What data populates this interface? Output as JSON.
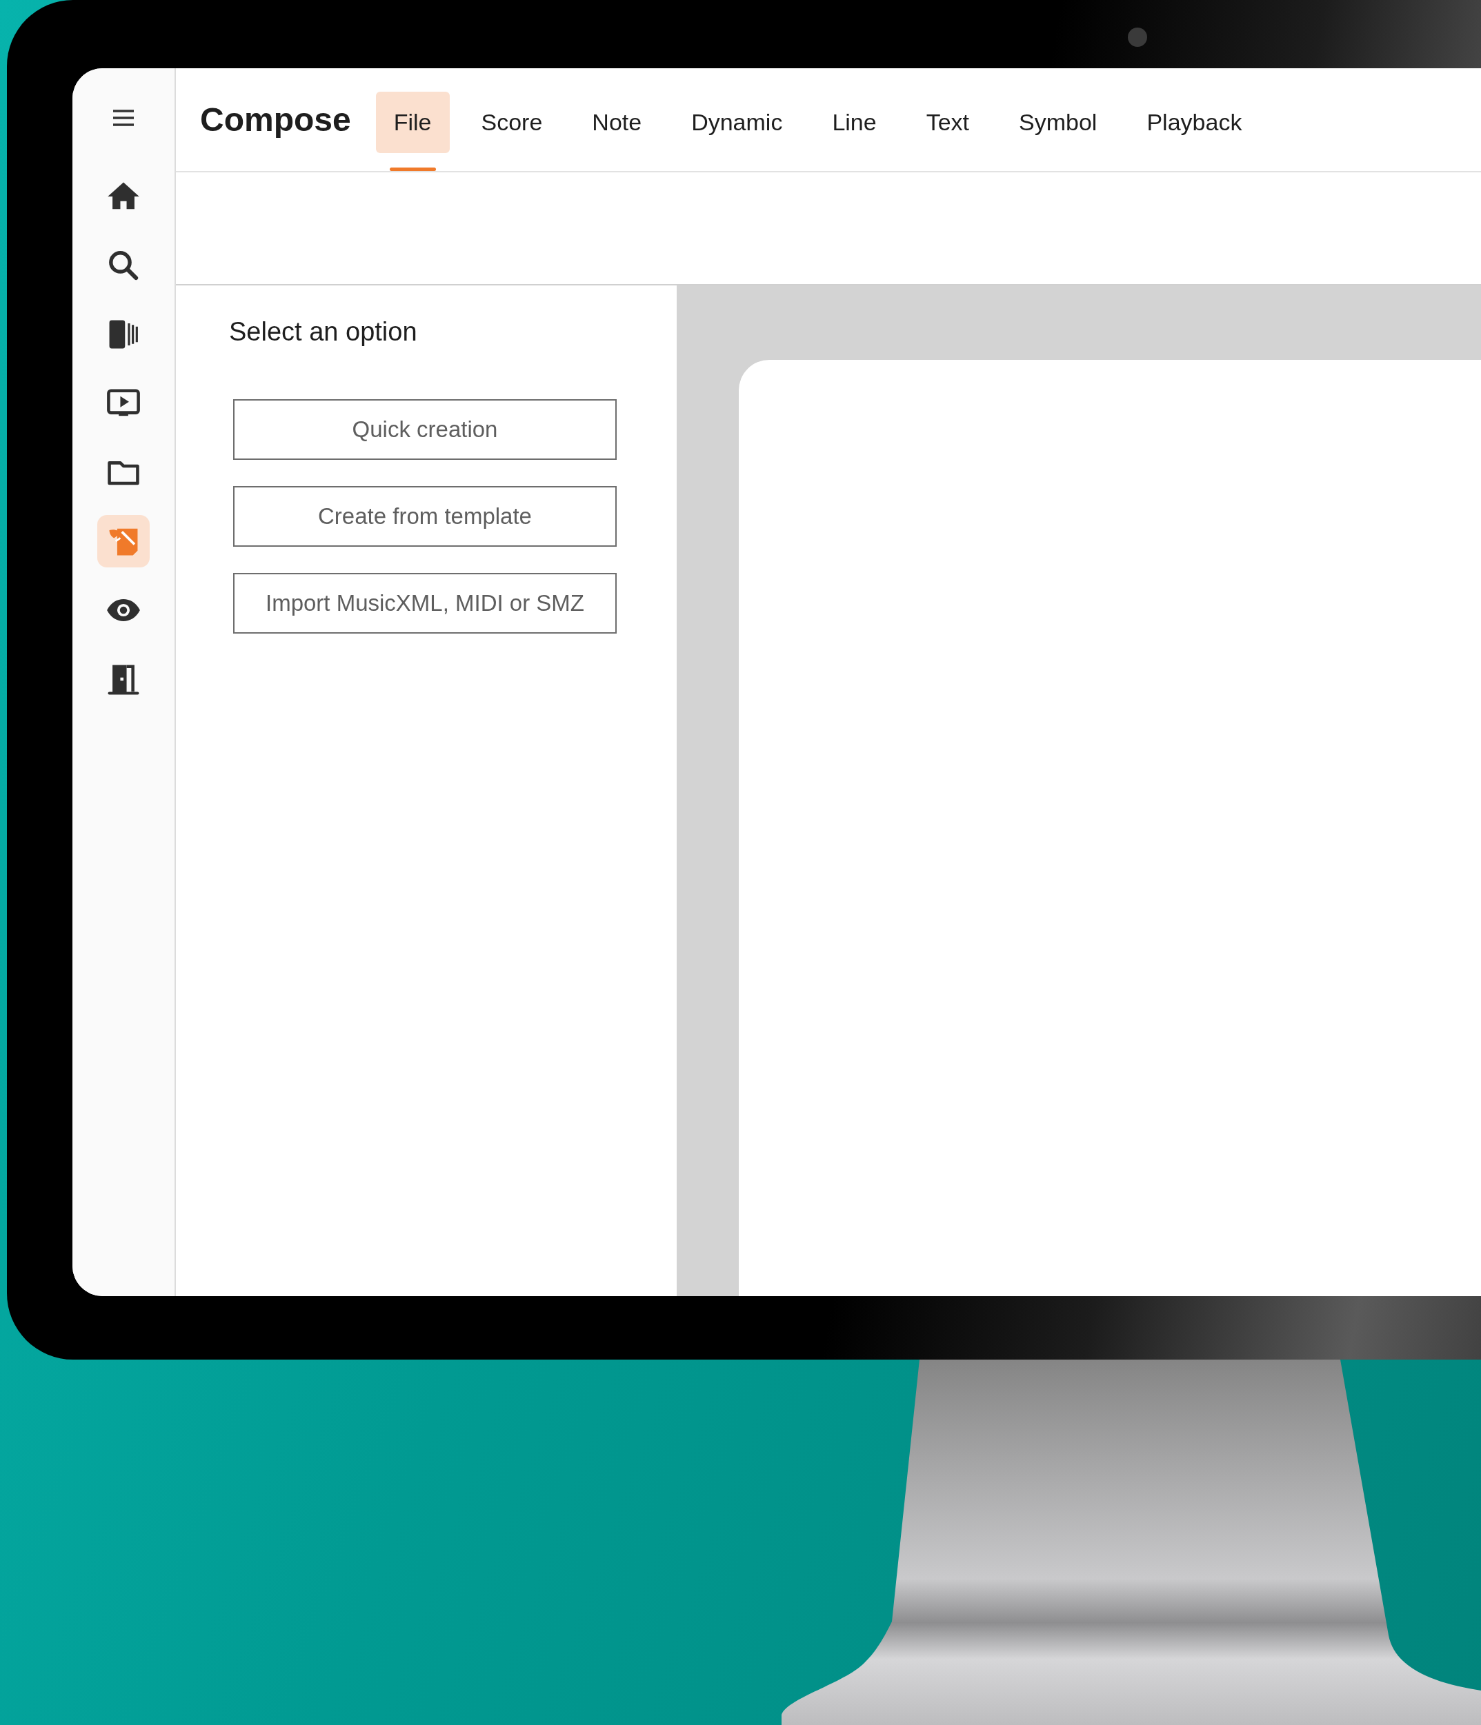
{
  "app": {
    "title": "Compose"
  },
  "sidebar": {
    "items": [
      {
        "selected": false
      },
      {
        "selected": false
      },
      {
        "selected": false
      },
      {
        "selected": false
      },
      {
        "selected": false
      },
      {
        "selected": true
      },
      {
        "selected": false
      },
      {
        "selected": false
      }
    ]
  },
  "tabs": [
    {
      "label": "File",
      "selected": true
    },
    {
      "label": "Score",
      "selected": false
    },
    {
      "label": "Note",
      "selected": false
    },
    {
      "label": "Dynamic",
      "selected": false
    },
    {
      "label": "Line",
      "selected": false
    },
    {
      "label": "Text",
      "selected": false
    },
    {
      "label": "Symbol",
      "selected": false
    },
    {
      "label": "Playback",
      "selected": false
    }
  ],
  "panel": {
    "heading": "Select an option",
    "options": [
      "Quick creation",
      "Create from template",
      "Import MusicXML, MIDI or SMZ"
    ]
  }
}
